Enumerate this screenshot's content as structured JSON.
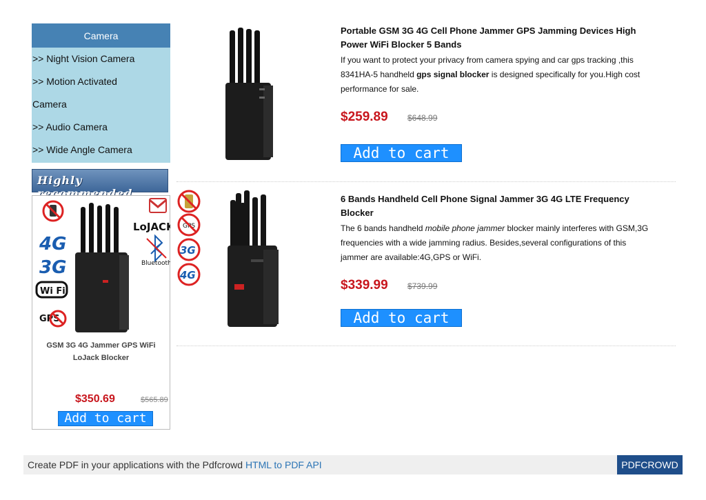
{
  "sidebar": {
    "heading": "Camera",
    "items": [
      {
        "label": ">> Night Vision Camera"
      },
      {
        "label": ">> Motion Activated"
      },
      {
        "label": "Camera"
      },
      {
        "label": ">> Audio Camera"
      },
      {
        "label": ">> Wide Angle Camera"
      }
    ]
  },
  "recommended": {
    "banner": "Highly recommended",
    "badges": [
      "4G",
      "3G",
      "Wi Fi",
      "GPS",
      "LoJACK",
      "Bluetooth"
    ],
    "title_line1": "GSM 3G 4G Jammer GPS WiFi",
    "title_line2": "LoJack Blocker",
    "price": "$350.69",
    "old_price": "$565.89",
    "cart_label": "Add to cart"
  },
  "products": [
    {
      "title_line1": "Portable GSM 3G 4G Cell Phone Jammer GPS Jamming Devices High",
      "title_line2": "Power WiFi Blocker 5 Bands",
      "desc": {
        "line1": "If you want to protect your privacy from camera spying and car gps tracking ,this",
        "line2_pre": "8341HA-5 handheld ",
        "line2_bold": "gps signal blocker",
        "line2_post": " is designed specifically for you.High cost",
        "line3": "performance for sale."
      },
      "price": "$259.89",
      "old_price": "$648.99",
      "cart_label": "Add to cart"
    },
    {
      "title_line1": "6 Bands Handheld Cell Phone Signal Jammer 3G 4G LTE Frequency",
      "title_line2": "Blocker",
      "desc": {
        "line1_pre": "The 6 bands handheld ",
        "line1_ital": "mobile phone jammer",
        "line1_post": " blocker mainly interferes with GSM,3G",
        "line2": "frequencies with a wide jamming radius. Besides,several configurations of this",
        "line3": "jammer are available:4G,GPS or WiFi."
      },
      "price": "$339.99",
      "old_price": "$739.99",
      "cart_label": "Add to cart"
    }
  ],
  "footer": {
    "text": "Create PDF in your applications with the Pdfcrowd ",
    "link": "HTML to PDF API",
    "button": "PDFCROWD"
  }
}
